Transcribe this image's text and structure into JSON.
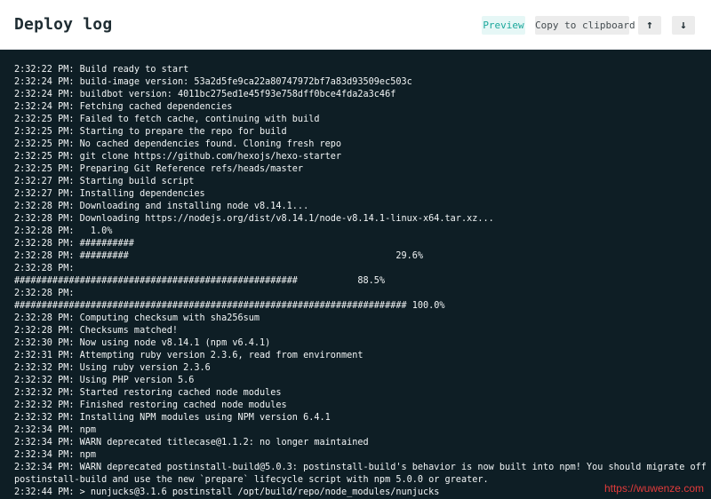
{
  "header": {
    "title": "Deploy log",
    "preview_label": "Preview",
    "copy_label": "Copy to clipboard",
    "scroll_up_icon": "↑",
    "scroll_down_icon": "↓"
  },
  "log_lines": [
    "2:32:22 PM: Build ready to start",
    "2:32:24 PM: build-image version: 53a2d5fe9ca22a80747972bf7a83d93509ec503c",
    "2:32:24 PM: buildbot version: 4011bc275ed1e45f93e758dff0bce4fda2a3c46f",
    "2:32:24 PM: Fetching cached dependencies",
    "2:32:25 PM: Failed to fetch cache, continuing with build",
    "2:32:25 PM: Starting to prepare the repo for build",
    "2:32:25 PM: No cached dependencies found. Cloning fresh repo",
    "2:32:25 PM: git clone https://github.com/hexojs/hexo-starter",
    "2:32:25 PM: Preparing Git Reference refs/heads/master",
    "2:32:27 PM: Starting build script",
    "2:32:27 PM: Installing dependencies",
    "2:32:28 PM: Downloading and installing node v8.14.1...",
    "2:32:28 PM: Downloading https://nodejs.org/dist/v8.14.1/node-v8.14.1-linux-x64.tar.xz...",
    "2:32:28 PM:   1.0%",
    "2:32:28 PM: ##########",
    "2:32:28 PM: #########                                                 29.6%",
    "2:32:28 PM:",
    "####################################################           88.5%",
    "2:32:28 PM:",
    "######################################################################## 100.0%",
    "2:32:28 PM: Computing checksum with sha256sum",
    "2:32:28 PM: Checksums matched!",
    "2:32:30 PM: Now using node v8.14.1 (npm v6.4.1)",
    "2:32:31 PM: Attempting ruby version 2.3.6, read from environment",
    "2:32:32 PM: Using ruby version 2.3.6",
    "2:32:32 PM: Using PHP version 5.6",
    "2:32:32 PM: Started restoring cached node modules",
    "2:32:32 PM: Finished restoring cached node modules",
    "2:32:32 PM: Installing NPM modules using NPM version 6.4.1",
    "2:32:34 PM: npm",
    "2:32:34 PM: WARN deprecated titlecase@1.1.2: no longer maintained",
    "2:32:34 PM: npm",
    "2:32:34 PM: WARN deprecated postinstall-build@5.0.3: postinstall-build's behavior is now built into npm! You should migrate off of",
    "postinstall-build and use the new `prepare` lifecycle script with npm 5.0.0 or greater.",
    "2:32:44 PM: > nunjucks@3.1.6 postinstall /opt/build/repo/node_modules/nunjucks"
  ],
  "watermark": "https://wuwenze.com"
}
